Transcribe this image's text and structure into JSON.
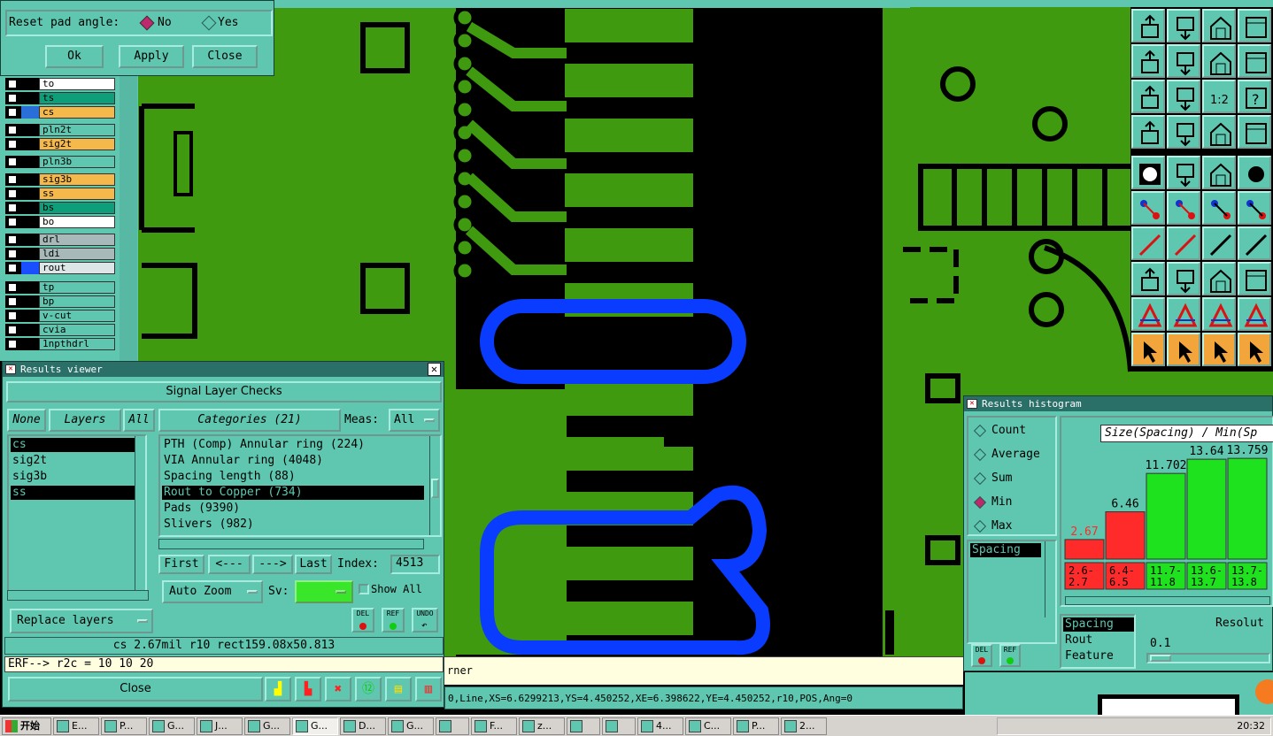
{
  "pad_dialog": {
    "reset_label": "Reset pad angle:",
    "opt_no": "No",
    "opt_yes": "Yes",
    "ok": "Ok",
    "apply": "Apply",
    "close": "Close"
  },
  "layers": [
    {
      "name": "to",
      "fill": "#ffffff",
      "swatch": "#000000"
    },
    {
      "name": "ts",
      "fill": "#0e9f7a",
      "swatch": "#000000"
    },
    {
      "name": "cs",
      "fill": "#f5b84a",
      "swatch": "#2a6fd8"
    },
    {
      "name": "pln2t",
      "fill": "#5fc7b0",
      "swatch": "#000000"
    },
    {
      "name": "sig2t",
      "fill": "#f5b84a",
      "swatch": "#000000"
    },
    {
      "name": "pln3b",
      "fill": "#5fc7b0",
      "swatch": "#000000"
    },
    {
      "name": "sig3b",
      "fill": "#f5b84a",
      "swatch": "#000000"
    },
    {
      "name": "ss",
      "fill": "#f5b84a",
      "swatch": "#000000"
    },
    {
      "name": "bs",
      "fill": "#0e9f7a",
      "swatch": "#000000"
    },
    {
      "name": "bo",
      "fill": "#ffffff",
      "swatch": "#000000"
    },
    {
      "name": "drl",
      "fill": "#a7b9b9",
      "swatch": "#000000"
    },
    {
      "name": "ldi",
      "fill": "#a7b9b9",
      "swatch": "#000000"
    },
    {
      "name": "rout",
      "fill": "#dde6e6",
      "swatch": "#1a4fff"
    },
    {
      "name": "tp",
      "fill": "#5fc7b0",
      "swatch": "#000000"
    },
    {
      "name": "bp",
      "fill": "#5fc7b0",
      "swatch": "#000000"
    },
    {
      "name": "v-cut",
      "fill": "#5fc7b0",
      "swatch": "#000000"
    },
    {
      "name": "cvia",
      "fill": "#5fc7b0",
      "swatch": "#000000"
    },
    {
      "name": "1npthdrl",
      "fill": "#5fc7b0",
      "swatch": "#000000"
    }
  ],
  "results_viewer": {
    "title": "Results viewer",
    "header": "Signal Layer Checks",
    "none": "None",
    "layers_btn": "Layers",
    "all": "All",
    "categories_btn": "Categories (21)",
    "meas_label": "Meas:",
    "meas_value": "All",
    "layer_list": [
      "cs",
      "sig2t",
      "sig3b",
      "ss"
    ],
    "category_list": [
      "PTH (Comp) Annular ring (224)",
      "VIA Annular ring (4048)",
      "Spacing length (88)",
      "Rout to Copper (734)",
      "Pads (9390)",
      "Slivers (982)"
    ],
    "first": "First",
    "prev": "<---",
    "next": "--->",
    "last": "Last",
    "index_label": "Index:",
    "index_value": "4513",
    "auto_zoom": "Auto Zoom",
    "sv_label": "Sv:",
    "show_all": "Show All",
    "replace_layers": "Replace layers",
    "del": "DEL",
    "ref": "REF",
    "undo": "UNDO",
    "status": "cs 2.67mil  r10  rect159.08x50.813",
    "erf": "ERF--> r2c = 10 10 20",
    "close": "Close"
  },
  "status_bar": {
    "left_text": "rner",
    "coord_text": "0,Line,XS=6.6299213,YS=4.450252,XE=6.398622,YE=4.450252,r10,POS,Ang=0"
  },
  "histogram": {
    "title": "Results histogram",
    "options": [
      "Count",
      "Average",
      "Sum",
      "Min",
      "Max"
    ],
    "selected": "Min",
    "header": "Size(Spacing) / Min(Sp",
    "list": [
      "Spacing"
    ],
    "bars": [
      {
        "label": "2.67",
        "range": "2.6-\n2.7",
        "value": 2.67,
        "color": "#ff2a2a",
        "labelColor": "#ff2a2a"
      },
      {
        "label": "6.46",
        "range": "6.4-\n6.5",
        "value": 6.46,
        "color": "#ff2a2a",
        "labelColor": "#000000"
      },
      {
        "label": "11.702",
        "range": "11.7-\n11.8",
        "value": 11.702,
        "color": "#1ee21e",
        "labelColor": "#000000"
      },
      {
        "label": "13.64",
        "range": "13.6-\n13.7",
        "value": 13.64,
        "color": "#1ee21e",
        "labelColor": "#000000"
      },
      {
        "label": "13.759",
        "range": "13.7-\n13.8",
        "value": 13.759,
        "color": "#1ee21e",
        "labelColor": "#000000"
      }
    ],
    "axis_list": [
      "Spacing",
      "Rout",
      "Feature"
    ],
    "resolution_label": "Resolut",
    "resolution_value": "0.1",
    "del": "DEL",
    "ref": "REF"
  },
  "taskbar": {
    "start": "开始",
    "tasks": [
      "E...",
      "P...",
      "G...",
      "J...",
      "G...",
      "G...",
      "D...",
      "G...",
      "",
      "F...",
      "z...",
      "",
      "",
      "4...",
      "C...",
      "P...",
      "2..."
    ],
    "clock": "20:32"
  },
  "colors": {
    "copper": "#3f9a10",
    "rout": "#0a3cff",
    "panel": "#5fc7b0",
    "title": "#2a6f68"
  }
}
